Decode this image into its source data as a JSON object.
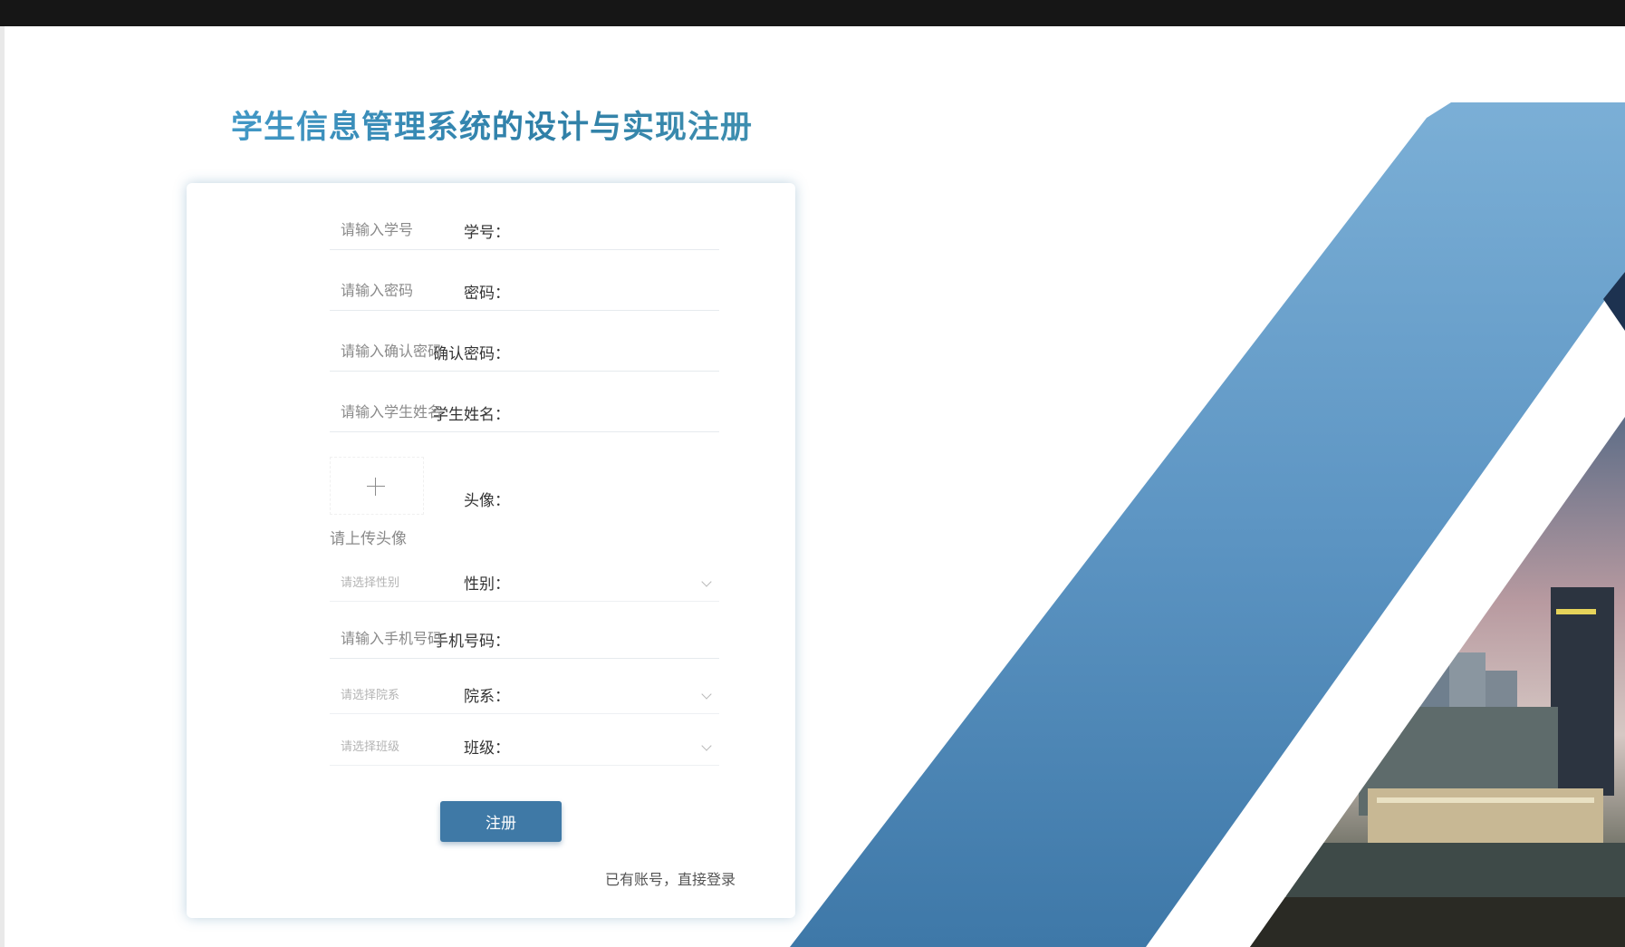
{
  "page": {
    "title": "学生信息管理系统的设计与实现注册"
  },
  "form": {
    "student_id": {
      "label": "学号",
      "placeholder": "请输入学号"
    },
    "password": {
      "label": "密码",
      "placeholder": "请输入密码"
    },
    "confirm_password": {
      "label": "确认密码",
      "placeholder": "请输入确认密码"
    },
    "student_name": {
      "label": "学生姓名",
      "placeholder": "请输入学生姓名"
    },
    "avatar": {
      "label": "头像",
      "hint": "请上传头像"
    },
    "gender": {
      "label": "性别",
      "placeholder": "请选择性别"
    },
    "phone": {
      "label": "手机号码",
      "placeholder": "请输入手机号码"
    },
    "department": {
      "label": "院系",
      "placeholder": "请选择院系"
    },
    "class": {
      "label": "班级",
      "placeholder": "请选择班级"
    },
    "submit_label": "注册",
    "login_link": "已有账号，直接登录"
  },
  "colors": {
    "accent": "#3f79a6",
    "title": "#3a8fb8",
    "stripe": "#4a86b5"
  }
}
